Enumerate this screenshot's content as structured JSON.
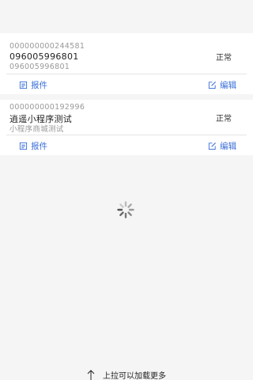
{
  "records": [
    {
      "code": "000000000244581",
      "name": "096005996801",
      "subtitle": "096005996801",
      "status": "正常",
      "report_label": "报件",
      "edit_label": "编辑"
    },
    {
      "code": "000000000192996",
      "name": "逍遥小程序测试",
      "subtitle": "小程序商城测试",
      "status": "正常",
      "report_label": "报件",
      "edit_label": "编辑"
    }
  ],
  "icons": {
    "report": "report-doc-icon",
    "edit": "edit-pencil-icon",
    "loading": "loading-spinner-icon",
    "pull": "arrow-up-icon"
  },
  "colors": {
    "accent": "#3a6fd8",
    "background": "#f5f5f5",
    "card": "#ffffff"
  },
  "footer": {
    "pull_hint": "上拉可以加载更多"
  }
}
